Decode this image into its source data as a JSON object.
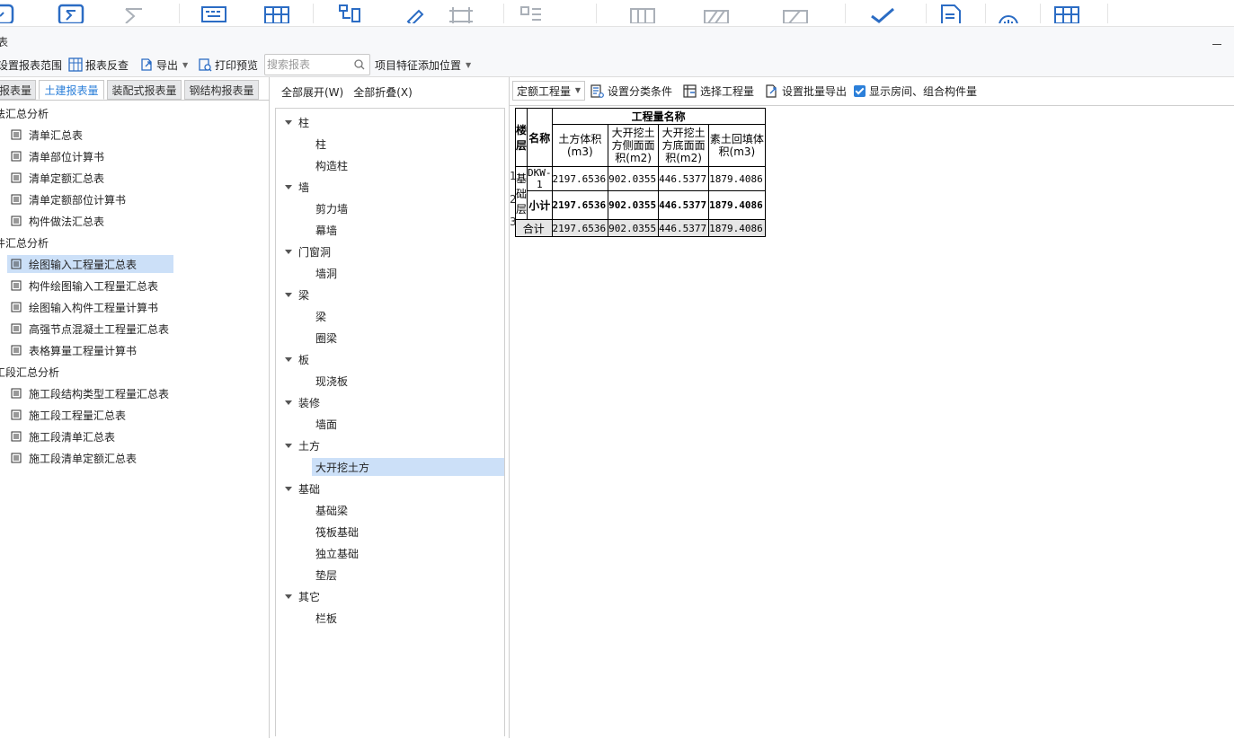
{
  "title_bar": {
    "title": "表"
  },
  "toolbar": {
    "set_range": "设置报表范围",
    "reverse_check": "报表反查",
    "export": "导出",
    "print_preview": "打印预览",
    "search_placeholder": "搜索报表",
    "feature_position": "项目特征添加位置"
  },
  "left_tabs": [
    "报表量",
    "土建报表量",
    "装配式报表量",
    "钢结构报表量"
  ],
  "left_tree": {
    "cat1": "法汇总分析",
    "cat1_items": [
      "清单汇总表",
      "清单部位计算书",
      "清单定额汇总表",
      "清单定额部位计算书",
      "构件做法汇总表"
    ],
    "cat2": "件汇总分析",
    "cat2_items": [
      "绘图输入工程量汇总表",
      "构件绘图输入工程量汇总表",
      "绘图输入构件工程量计算书",
      "高强节点混凝土工程量汇总表",
      "表格算量工程量计算书"
    ],
    "cat3": "工段汇总分析",
    "cat3_items": [
      "施工段结构类型工程量汇总表",
      "施工段工程量汇总表",
      "施工段清单汇总表",
      "施工段清单定额汇总表"
    ]
  },
  "mid": {
    "expand_all": "全部展开(W)",
    "collapse_all": "全部折叠(X)",
    "tree": [
      {
        "group": "柱",
        "children": [
          "柱",
          "构造柱"
        ]
      },
      {
        "group": "墙",
        "children": [
          "剪力墙",
          "幕墙"
        ]
      },
      {
        "group": "门窗洞",
        "children": [
          "墙洞"
        ]
      },
      {
        "group": "梁",
        "children": [
          "梁",
          "圈梁"
        ]
      },
      {
        "group": "板",
        "children": [
          "现浇板"
        ]
      },
      {
        "group": "装修",
        "children": [
          "墙面"
        ]
      },
      {
        "group": "土方",
        "children": [
          "大开挖土方"
        ]
      },
      {
        "group": "基础",
        "children": [
          "基础梁",
          "筏板基础",
          "独立基础",
          "垫层"
        ]
      },
      {
        "group": "其它",
        "children": [
          "栏板"
        ]
      }
    ]
  },
  "right_toolbar": {
    "dropdown": "定额工程量",
    "set_category": "设置分类条件",
    "select_quantity": "选择工程量",
    "batch_export": "设置批量导出",
    "show_room": "显示房间、组合构件量"
  },
  "report": {
    "col_floor": "楼层",
    "col_name": "名称",
    "group_header": "工程量名称",
    "q_headers": [
      "土方体积(m3)",
      "大开挖土方侧面面积(m2)",
      "大开挖土方底面面积(m2)",
      "素土回填体积(m3)"
    ],
    "row_numbers": [
      "1",
      "2",
      "3"
    ],
    "floor": "基础层",
    "row1_name": "DKW-1",
    "row1_values": [
      "2197.6536",
      "902.0355",
      "446.5377",
      "1879.4086"
    ],
    "row2_name": "小计",
    "row2_values": [
      "2197.6536",
      "902.0355",
      "446.5377",
      "1879.4086"
    ],
    "row3_name": "合计",
    "row3_values": [
      "2197.6536",
      "902.0355",
      "446.5377",
      "1879.4086"
    ]
  }
}
